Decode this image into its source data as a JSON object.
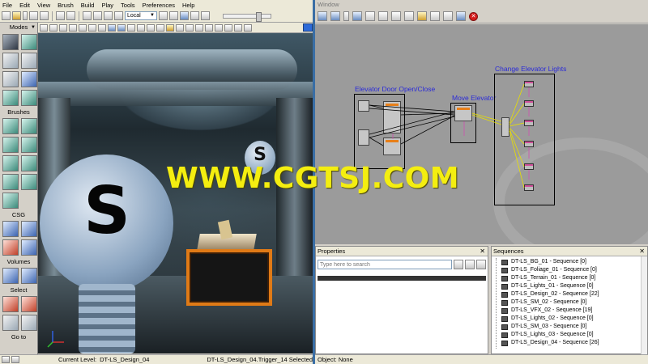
{
  "menu": [
    "File",
    "Edit",
    "View",
    "Brush",
    "Build",
    "Play",
    "Tools",
    "Preferences",
    "Help"
  ],
  "toolbar": {
    "coord_system": "Local"
  },
  "modes_panel": {
    "title": "Modes",
    "sections": [
      "Brushes",
      "CSG",
      "Volumes",
      "Select",
      "Go to"
    ]
  },
  "watermark": "WWW.CGTSJ.COM",
  "viewport": {
    "big_bulb_letter": "S",
    "small_bulb_letter": "S"
  },
  "status": {
    "current_level_label": "Current Level:",
    "current_level_value": "DT-LS_Design_04",
    "selection": "DT-LS_Design_04.Trigger_14 Selected"
  },
  "kismet": {
    "window_title": "Window",
    "sequences_in_graph": [
      "Elevator Door Open/Close",
      "Move Elevator",
      "Change Elevator Lights"
    ]
  },
  "properties_panel": {
    "title": "Properties",
    "search_placeholder": "Type here to search"
  },
  "sequences_panel": {
    "title": "Sequences",
    "items": [
      "DT-LS_BG_01 - Sequence [0]",
      "DT-LS_Foliage_01 - Sequence [0]",
      "DT-LS_Terrain_01 - Sequence [0]",
      "DT-LS_Lights_01 - Sequence [0]",
      "DT-LS_Design_02 - Sequence [22]",
      "DT-LS_SM_02 - Sequence [0]",
      "DT-LS_VFX_02 - Sequence [19]",
      "DT-LS_Lights_02 - Sequence [0]",
      "DT-LS_SM_03 - Sequence [0]",
      "DT-LS_Lights_03 - Sequence [0]",
      "DT-LS_Design_04 - Sequence [26]"
    ]
  },
  "object_status": "Object: None",
  "colors": {
    "watermark": "#f4ee10",
    "trigger_border": "#e07a16",
    "sequence_label": "#2a2ad8",
    "accent": "#3a6ea5"
  }
}
